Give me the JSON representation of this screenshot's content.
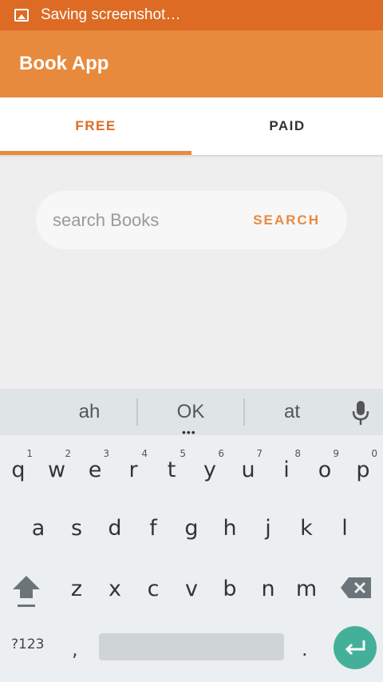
{
  "status_bar": {
    "text": "Saving screenshot…",
    "icon": "image-icon"
  },
  "app_bar": {
    "title": "Book App"
  },
  "tabs": [
    {
      "label": "FREE",
      "active": true
    },
    {
      "label": "PAID",
      "active": false
    }
  ],
  "search": {
    "placeholder": "search Books",
    "value": "",
    "button_label": "SEARCH"
  },
  "keyboard": {
    "suggestions": [
      "ah",
      "OK",
      "at"
    ],
    "more_indicator": "•••",
    "row1": [
      {
        "ch": "q",
        "hint": "1"
      },
      {
        "ch": "w",
        "hint": "2"
      },
      {
        "ch": "e",
        "hint": "3"
      },
      {
        "ch": "r",
        "hint": "4"
      },
      {
        "ch": "t",
        "hint": "5"
      },
      {
        "ch": "y",
        "hint": "6"
      },
      {
        "ch": "u",
        "hint": "7"
      },
      {
        "ch": "i",
        "hint": "8"
      },
      {
        "ch": "o",
        "hint": "9"
      },
      {
        "ch": "p",
        "hint": "0"
      }
    ],
    "row2": [
      "a",
      "s",
      "d",
      "f",
      "g",
      "h",
      "j",
      "k",
      "l"
    ],
    "row3": [
      "z",
      "x",
      "c",
      "v",
      "b",
      "n",
      "m"
    ],
    "symbols_label": "?123",
    "comma": ",",
    "period": ".",
    "colors": {
      "accent": "#e88a3e",
      "status_bar": "#dd6b24",
      "enter": "#45b09a"
    }
  }
}
